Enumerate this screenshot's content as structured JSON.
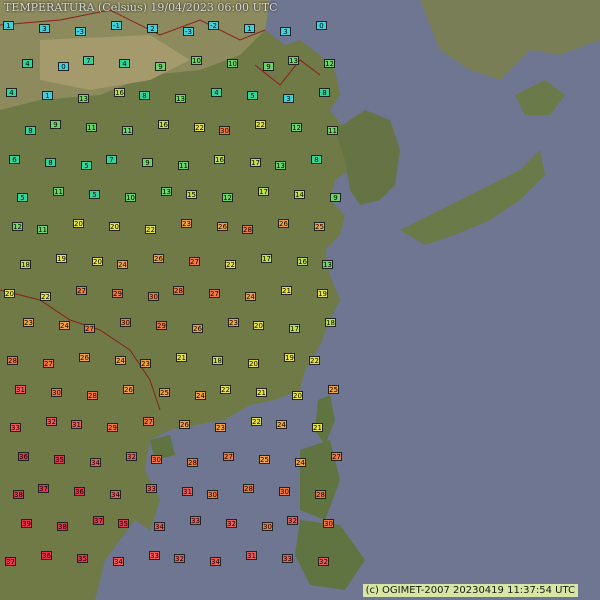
{
  "title": "TEMPERATURA (Celsius)   19/04/2023 06:00 UTC",
  "credit": "(c) OGIMET-2007 20230419 11:37:54 UTC",
  "colors": {
    "sea": "#6e7692",
    "cold": "#3fd1d9",
    "cool": "#2fd59a",
    "mild": "#6ed46a",
    "warm": "#bde04a",
    "hot": "#e6e43a",
    "orange": "#f2a33a",
    "deep_orange": "#f07a3a",
    "red": "#f15a5a",
    "crimson": "#e8334e"
  },
  "stations": [
    {
      "v": "1"
    },
    {
      "v": "3"
    },
    {
      "v": "-3"
    },
    {
      "v": "-1"
    },
    {
      "v": "2"
    },
    {
      "v": "-3"
    },
    {
      "v": "-2"
    },
    {
      "v": "1"
    },
    {
      "v": "3"
    },
    {
      "v": "0"
    },
    {
      "v": "4"
    },
    {
      "v": "0"
    },
    {
      "v": "7"
    },
    {
      "v": "4"
    },
    {
      "v": "9"
    },
    {
      "v": "10"
    },
    {
      "v": "10"
    },
    {
      "v": "9"
    },
    {
      "v": "13"
    },
    {
      "v": "12"
    },
    {
      "v": "4"
    },
    {
      "v": "1"
    },
    {
      "v": "13"
    },
    {
      "v": "16"
    },
    {
      "v": "8"
    },
    {
      "v": "13"
    },
    {
      "v": "4"
    },
    {
      "v": "5"
    },
    {
      "v": "3"
    },
    {
      "v": "8"
    },
    {
      "v": "8"
    },
    {
      "v": "9"
    },
    {
      "v": "11"
    },
    {
      "v": "11"
    },
    {
      "v": "16"
    },
    {
      "v": "22"
    },
    {
      "v": "30"
    },
    {
      "v": "22"
    },
    {
      "v": "12"
    },
    {
      "v": "11"
    },
    {
      "v": "6"
    },
    {
      "v": "8"
    },
    {
      "v": "5"
    },
    {
      "v": "7"
    },
    {
      "v": "9"
    },
    {
      "v": "11"
    },
    {
      "v": "16"
    },
    {
      "v": "17"
    },
    {
      "v": "13"
    },
    {
      "v": "8"
    },
    {
      "v": "5"
    },
    {
      "v": "11"
    },
    {
      "v": "5"
    },
    {
      "v": "10"
    },
    {
      "v": "13"
    },
    {
      "v": "15"
    },
    {
      "v": "12"
    },
    {
      "v": "17"
    },
    {
      "v": "14"
    },
    {
      "v": "9"
    },
    {
      "v": "12"
    },
    {
      "v": "11"
    },
    {
      "v": "20"
    },
    {
      "v": "20"
    },
    {
      "v": "22"
    },
    {
      "v": "23"
    },
    {
      "v": "26"
    },
    {
      "v": "28"
    },
    {
      "v": "26"
    },
    {
      "v": "25"
    },
    {
      "v": "18"
    },
    {
      "v": "19"
    },
    {
      "v": "20"
    },
    {
      "v": "24"
    },
    {
      "v": "26"
    },
    {
      "v": "27"
    },
    {
      "v": "22"
    },
    {
      "v": "17"
    },
    {
      "v": "16"
    },
    {
      "v": "13"
    },
    {
      "v": "20"
    },
    {
      "v": "22"
    },
    {
      "v": "27"
    },
    {
      "v": "29"
    },
    {
      "v": "30"
    },
    {
      "v": "28"
    },
    {
      "v": "27"
    },
    {
      "v": "24"
    },
    {
      "v": "21"
    },
    {
      "v": "19"
    },
    {
      "v": "23"
    },
    {
      "v": "24"
    },
    {
      "v": "27"
    },
    {
      "v": "30"
    },
    {
      "v": "29"
    },
    {
      "v": "26"
    },
    {
      "v": "23"
    },
    {
      "v": "20"
    },
    {
      "v": "17"
    },
    {
      "v": "18"
    },
    {
      "v": "28"
    },
    {
      "v": "27"
    },
    {
      "v": "26"
    },
    {
      "v": "24"
    },
    {
      "v": "23"
    },
    {
      "v": "21"
    },
    {
      "v": "18"
    },
    {
      "v": "20"
    },
    {
      "v": "19"
    },
    {
      "v": "22"
    },
    {
      "v": "31"
    },
    {
      "v": "30"
    },
    {
      "v": "28"
    },
    {
      "v": "26"
    },
    {
      "v": "25"
    },
    {
      "v": "24"
    },
    {
      "v": "22"
    },
    {
      "v": "21"
    },
    {
      "v": "20"
    },
    {
      "v": "25"
    },
    {
      "v": "33"
    },
    {
      "v": "32"
    },
    {
      "v": "31"
    },
    {
      "v": "29"
    },
    {
      "v": "27"
    },
    {
      "v": "26"
    },
    {
      "v": "23"
    },
    {
      "v": "22"
    },
    {
      "v": "24"
    },
    {
      "v": "21"
    },
    {
      "v": "36"
    },
    {
      "v": "35"
    },
    {
      "v": "34"
    },
    {
      "v": "32"
    },
    {
      "v": "30"
    },
    {
      "v": "28"
    },
    {
      "v": "27"
    },
    {
      "v": "25"
    },
    {
      "v": "24"
    },
    {
      "v": "27"
    },
    {
      "v": "38"
    },
    {
      "v": "37"
    },
    {
      "v": "36"
    },
    {
      "v": "34"
    },
    {
      "v": "33"
    },
    {
      "v": "31"
    },
    {
      "v": "30"
    },
    {
      "v": "28"
    },
    {
      "v": "30"
    },
    {
      "v": "28"
    },
    {
      "v": "39"
    },
    {
      "v": "38"
    },
    {
      "v": "37"
    },
    {
      "v": "35"
    },
    {
      "v": "34"
    },
    {
      "v": "33"
    },
    {
      "v": "32"
    },
    {
      "v": "30"
    },
    {
      "v": "32"
    },
    {
      "v": "30"
    },
    {
      "v": "37"
    },
    {
      "v": "36"
    },
    {
      "v": "35"
    },
    {
      "v": "34"
    },
    {
      "v": "33"
    },
    {
      "v": "32"
    },
    {
      "v": "34"
    },
    {
      "v": "31"
    },
    {
      "v": "33"
    },
    {
      "v": "32"
    }
  ]
}
